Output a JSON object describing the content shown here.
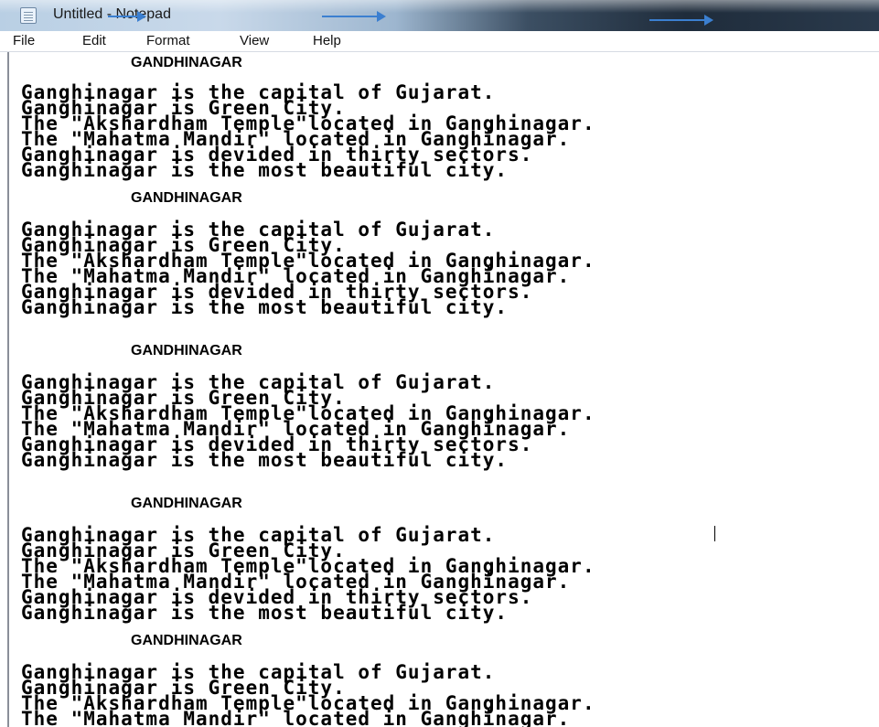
{
  "window": {
    "title": "Untitled - Notepad",
    "app_icon": "notepad-icon"
  },
  "menu": {
    "items": [
      "File",
      "Edit",
      "Format",
      "View",
      "Help"
    ]
  },
  "document": {
    "blocks": [
      {
        "heading": "GANDHINAGAR",
        "lines": [
          "Ganghinagar is the capital of Gujarat.",
          "Ganghinagar is Green City.",
          "The \"Akshardham Temple\"located in Ganghinagar.",
          "The \"Mahatma Mandir\" located in Ganghinagar.",
          "Ganghinagar is devided in thirty sectors.",
          "Ganghinagar is the most beautiful city."
        ]
      },
      {
        "heading": "GANDHINAGAR",
        "lines": [
          "Ganghinagar is the capital of Gujarat.",
          "Ganghinagar is Green City.",
          "The \"Akshardham Temple\"located in Ganghinagar.",
          "The \"Mahatma Mandir\" located in Ganghinagar.",
          "Ganghinagar is devided in thirty sectors.",
          "Ganghinagar is the most beautiful city."
        ]
      },
      {
        "heading": "GANDHINAGAR",
        "lines": [
          "Ganghinagar is the capital of Gujarat.",
          "Ganghinagar is Green City.",
          "The \"Akshardham Temple\"located in Ganghinagar.",
          "The \"Mahatma Mandir\" located in Ganghinagar.",
          "Ganghinagar is devided in thirty sectors.",
          "Ganghinagar is the most beautiful city."
        ]
      },
      {
        "heading": "GANDHINAGAR",
        "lines": [
          "Ganghinagar is the capital of Gujarat.",
          "Ganghinagar is Green City.",
          "The \"Akshardham Temple\"located in Ganghinagar.",
          "The \"Mahatma Mandir\" located in Ganghinagar.",
          "Ganghinagar is devided in thirty sectors.",
          "Ganghinagar is the most beautiful city."
        ]
      },
      {
        "heading": "GANDHINAGAR",
        "lines": [
          "Ganghinagar is the capital of Gujarat.",
          "Ganghinagar is Green City.",
          "The \"Akshardham Temple\"located in Ganghinagar.",
          "The \"Mahatma Mandir\" located in Ganghinagar."
        ]
      }
    ]
  },
  "colors": {
    "text": "#000000",
    "editor_background": "#ffffff",
    "annotation_arrow": "#3b7fd0"
  }
}
